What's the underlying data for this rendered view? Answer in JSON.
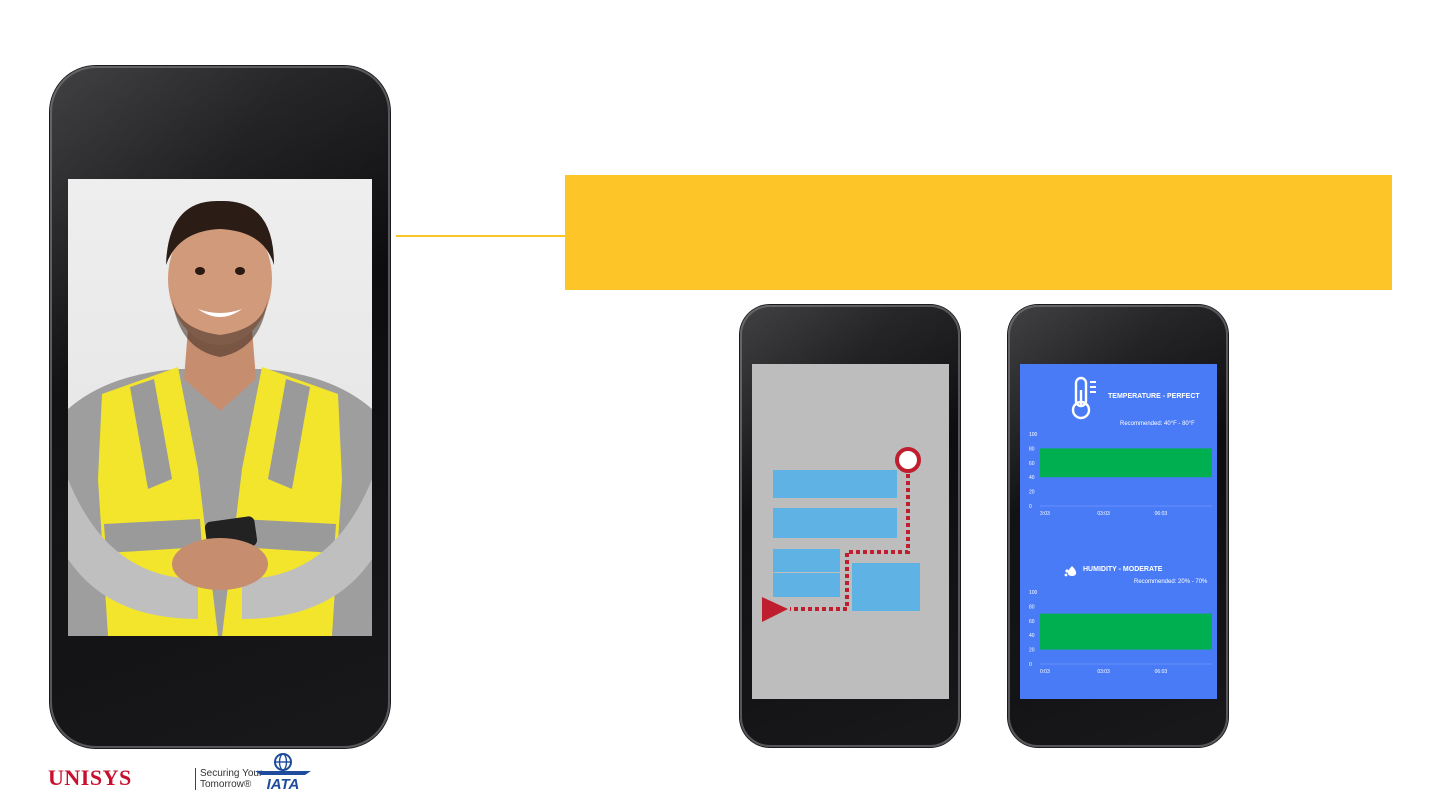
{
  "temperature_card": {
    "title": "TEMPERATURE - PERFECT",
    "recommended": "Recommended: 40°F - 80°F",
    "chart_data": {
      "type": "area",
      "y_ticks": [
        "100",
        "80",
        "60",
        "40",
        "20",
        "0"
      ],
      "x_ticks": [
        "3:03",
        "03:03",
        "06:03"
      ],
      "ylim": [
        0,
        100
      ],
      "band": [
        40,
        80
      ],
      "band_color": "#00b050"
    }
  },
  "humidity_card": {
    "title": "HUMIDITY - MODERATE",
    "recommended": "Recommended: 20% - 70%",
    "chart_data": {
      "type": "area",
      "y_ticks": [
        "100",
        "80",
        "60",
        "40",
        "20",
        "0"
      ],
      "x_ticks": [
        "0:03",
        "03:03",
        "06:03"
      ],
      "ylim": [
        0,
        100
      ],
      "band": [
        20,
        70
      ],
      "band_color": "#00b050"
    }
  },
  "footer": {
    "unisys": "UNISYS",
    "tagline_1": "Securing Your",
    "tagline_2": "Tomorrow®",
    "iata": "IATA"
  },
  "colors": {
    "banner": "#fdc528",
    "chart_screen": "#4a7bf7",
    "map_screen": "#bdbdbd",
    "map_block": "#5eb3e4",
    "route": "#be1e2d",
    "unisys_red": "#c8102e",
    "iata_blue": "#1e4b9b"
  }
}
